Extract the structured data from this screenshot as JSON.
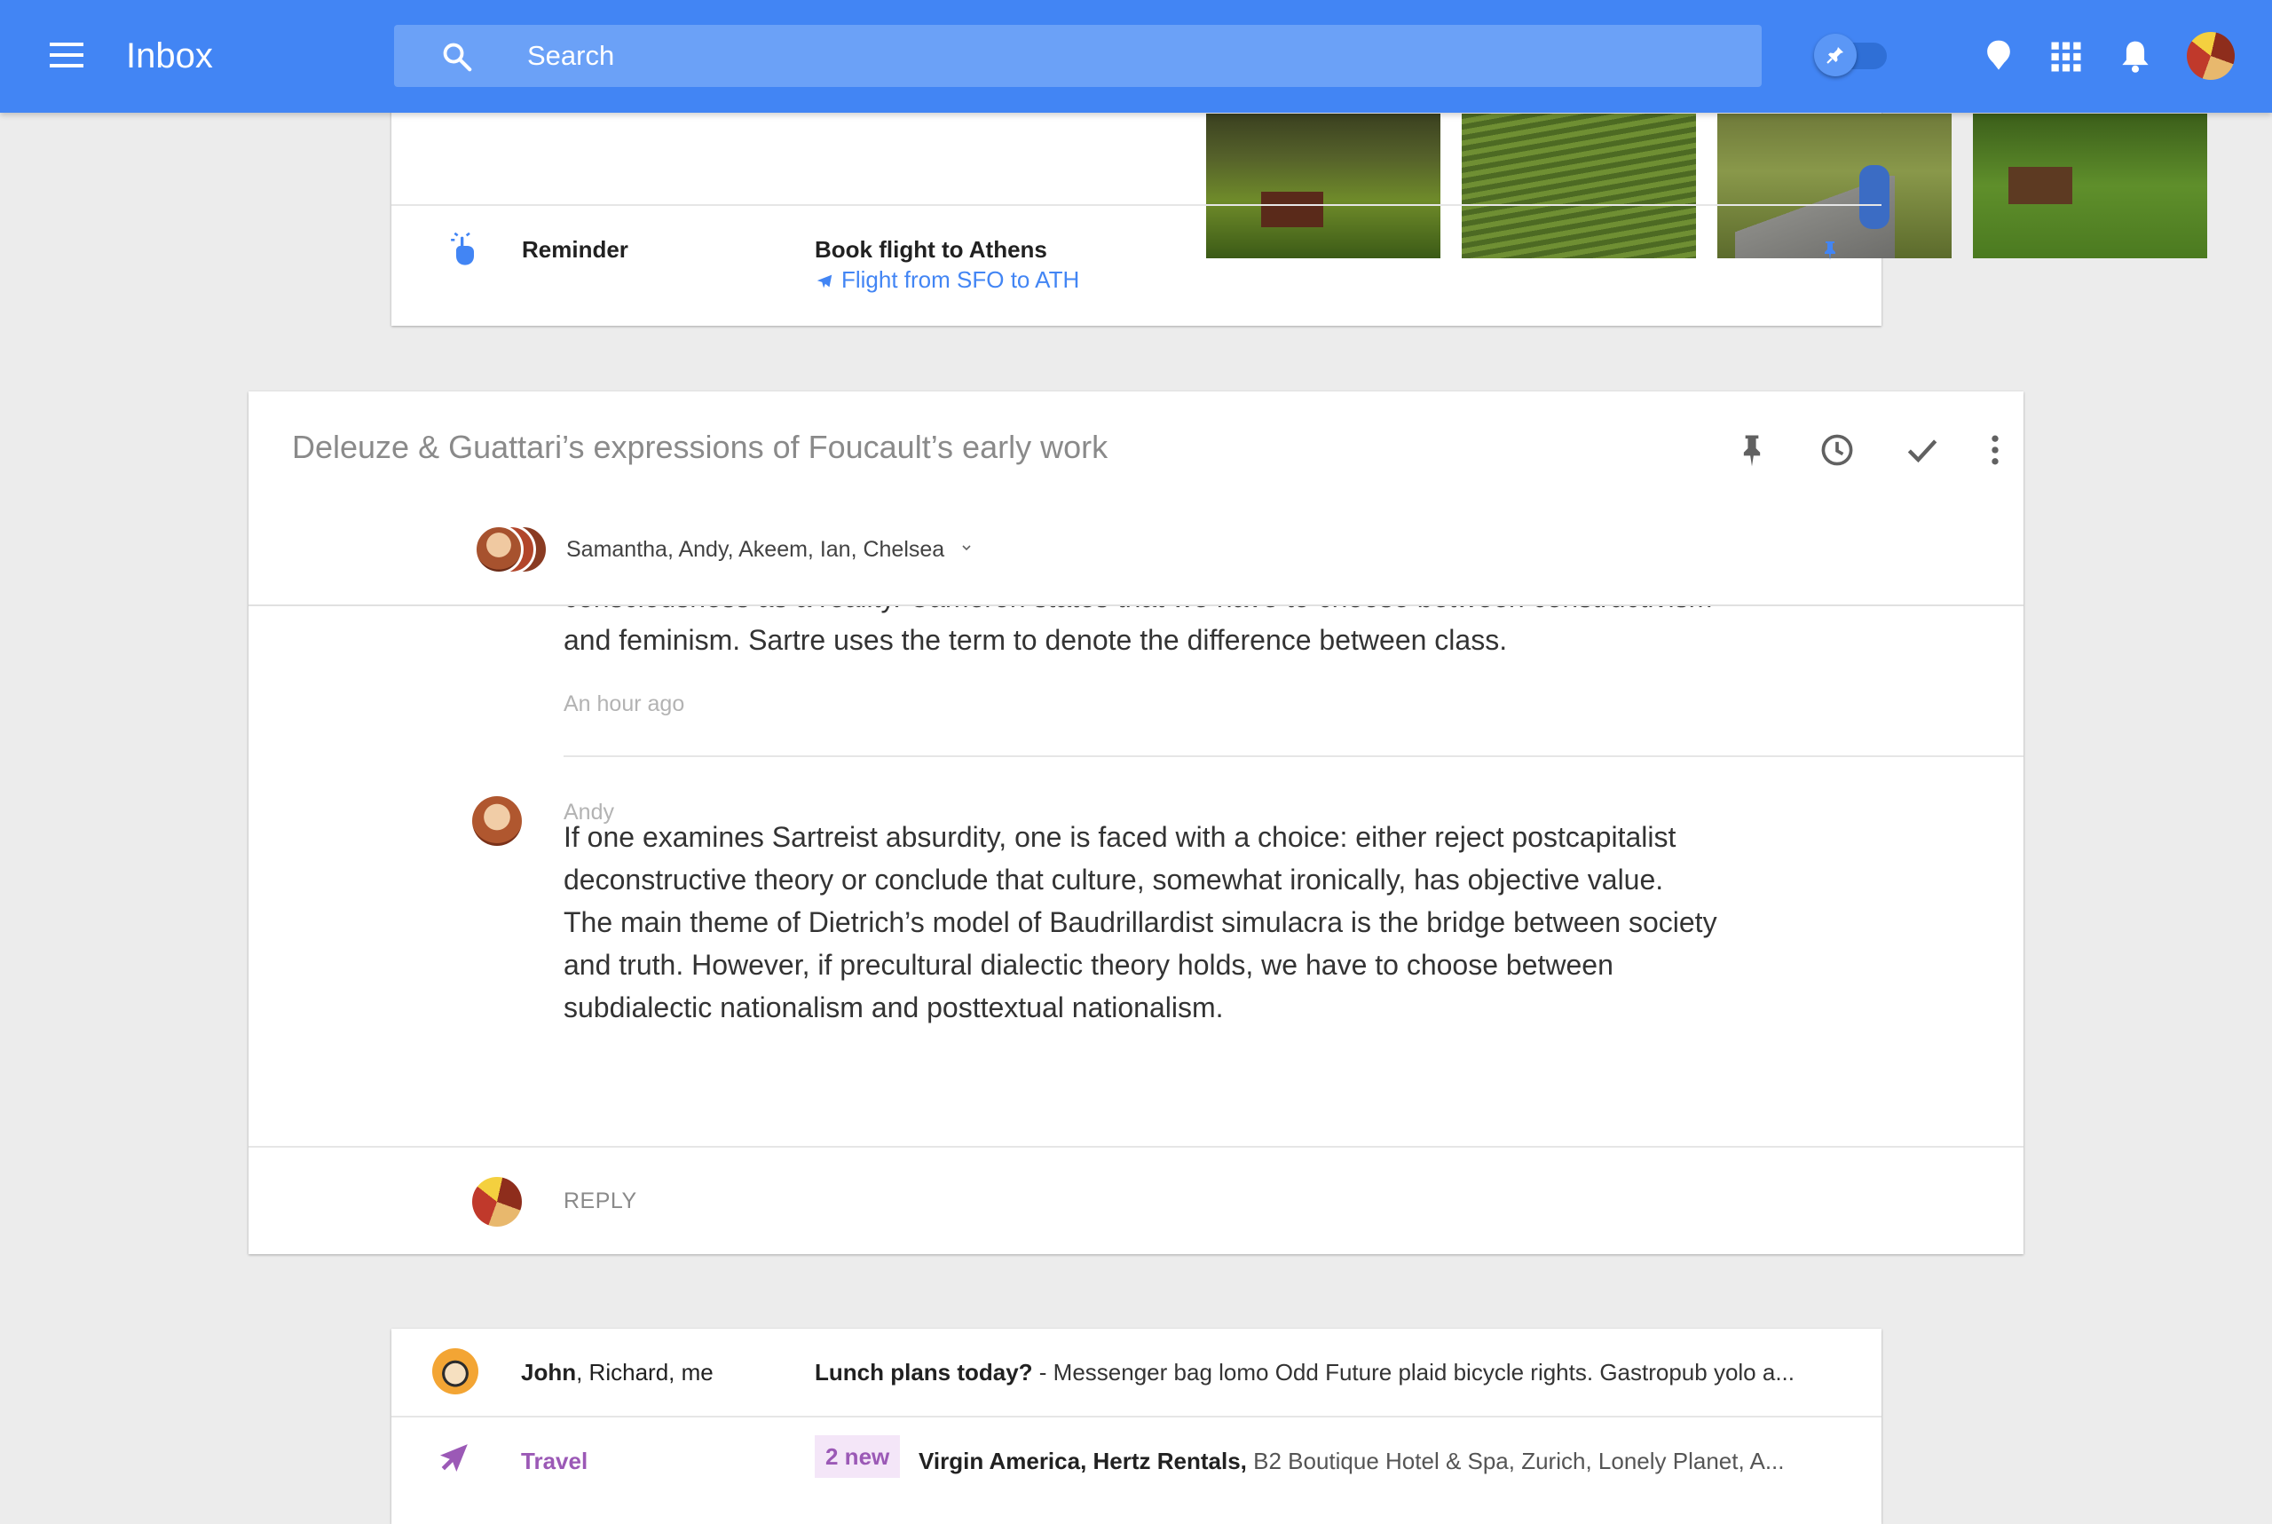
{
  "colors": {
    "topbar": "#4285f4",
    "accent_blue": "#4285f4",
    "travel_purple": "#9b59b6",
    "background": "#ececec"
  },
  "header": {
    "app_title": "Inbox",
    "search_placeholder": "Search",
    "icons": [
      "menu-icon",
      "search-icon",
      "pin-toggle",
      "reminder-bulb-icon",
      "apps-grid-icon",
      "notifications-bell-icon",
      "account-avatar"
    ]
  },
  "reminder_card": {
    "label": "Reminder",
    "title": "Book flight to Athens",
    "link": "Flight from SFO to ATH",
    "photos": 4
  },
  "thread": {
    "subject": "Deleuze & Guattari’s expressions of Foucault’s early work",
    "participants": "Samantha, Andy, Akeem, Ian, Chelsea",
    "actions": [
      "pin",
      "snooze",
      "done",
      "more"
    ],
    "previous_message": {
      "text": "consciousness as a reality. Cameron states that we have to choose between constructivism and feminism.  Sartre uses the term to denote the difference between class.",
      "time": "An hour ago"
    },
    "message": {
      "sender": "Andy",
      "text": "If one examines Sartreist absurdity, one is faced with a choice: either reject postcapitalist deconstructive theory or conclude that culture, somewhat ironically, has objective value. The main theme of Dietrich’s model of Baudrillardist simulacra is the bridge between society and truth. However, if precultural dialectic theory holds, we have to choose between subdialectic nationalism and posttextual nationalism."
    },
    "reply_label": "REPLY"
  },
  "list": {
    "row1": {
      "from_bold": "John",
      "from_rest": ", Richard, me",
      "subject": "Lunch plans today?",
      "snippet": "  - Messenger bag lomo Odd Future plaid bicycle rights. Gastropub yolo a..."
    },
    "row2": {
      "label": "Travel",
      "badge": "2 new",
      "senders": "Virgin America, Hertz Rentals,",
      "snippet": " B2 Boutique Hotel & Spa, Zurich, Lonely Planet, A..."
    }
  }
}
